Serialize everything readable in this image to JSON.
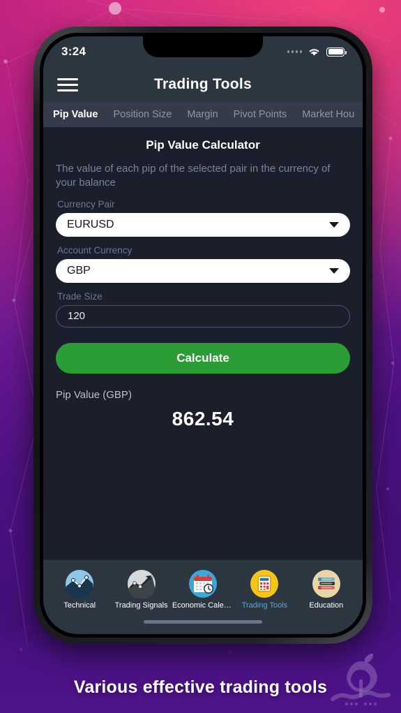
{
  "promo": {
    "caption": "Various effective trading tools",
    "watermark_name": "sibche-apple-logo"
  },
  "phone": {
    "status_bar": {
      "time": "3:24",
      "signal_icon": "signal-dots-icon",
      "wifi_icon": "wifi-icon",
      "battery_icon": "battery-full-icon"
    },
    "app_bar": {
      "menu_icon": "hamburger-menu-icon",
      "title": "Trading Tools"
    },
    "tabs": [
      {
        "label": "Pip Value",
        "active": true
      },
      {
        "label": "Position Size",
        "active": false
      },
      {
        "label": "Margin",
        "active": false
      },
      {
        "label": "Pivot Points",
        "active": false
      },
      {
        "label": "Market Hou",
        "active": false
      }
    ],
    "calculator": {
      "title": "Pip Value Calculator",
      "description": "The value of each pip of the selected pair in the currency of your balance",
      "currency_pair_label": "Currency Pair",
      "currency_pair_value": "EURUSD",
      "account_currency_label": "Account Currency",
      "account_currency_value": "GBP",
      "trade_size_label": "Trade Size",
      "trade_size_value": "120",
      "trade_size_placeholder": "Trade Size",
      "calculate_label": "Calculate",
      "result_label": "Pip Value (GBP)",
      "result_value": "862.54",
      "dropdown_icon": "chevron-down-icon",
      "accent_green": "#2b9c36"
    },
    "bottom_nav": [
      {
        "label": "Technical",
        "icon": "technical-chart-icon",
        "active": false
      },
      {
        "label": "Trading Signals",
        "icon": "trading-signals-icon",
        "active": false
      },
      {
        "label": "Economic Calen...",
        "icon": "economic-calendar-icon",
        "active": false
      },
      {
        "label": "Trading Tools",
        "icon": "calculator-icon",
        "active": true
      },
      {
        "label": "Education",
        "icon": "books-icon",
        "active": false
      }
    ],
    "home_indicator": "home-indicator-bar"
  },
  "colors": {
    "app_bar_bg": "#2b3641",
    "tab_bar_bg": "#353b4a",
    "content_bg": "#1a1f2b",
    "accent_green": "#2b9c36",
    "active_nav_text": "#5ba8d6"
  }
}
